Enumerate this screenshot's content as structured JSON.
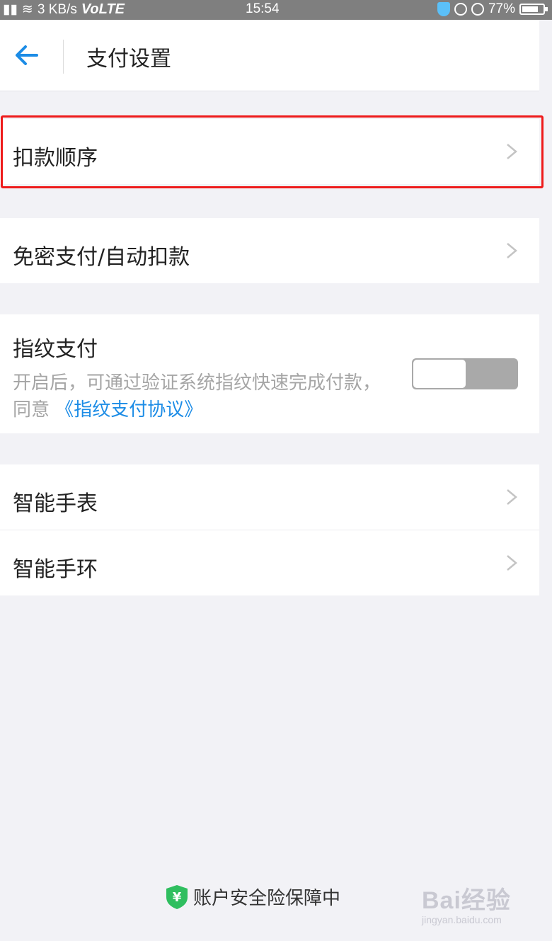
{
  "status_bar": {
    "speed": "3 KB/s",
    "network": "VoLTE",
    "time": "15:54",
    "battery": "77%"
  },
  "header": {
    "title": "支付设置"
  },
  "sections": {
    "deduction_order": "扣款顺序",
    "auto_pay": "免密支付/自动扣款",
    "fingerprint": {
      "title": "指纹支付",
      "desc": "开启后，可通过验证系统指纹快速完成付款，同意",
      "link": "《指纹支付协议》",
      "enabled": false
    },
    "smart_watch": "智能手表",
    "smart_band": "智能手环"
  },
  "footer": {
    "text": "账户安全险保障中"
  },
  "watermark": {
    "brand": "Bai经验",
    "url": "jingyan.baidu.com"
  },
  "colors": {
    "accent": "#1c8ce6",
    "highlight_border": "#ee1b1b",
    "shield_green": "#2fbe5f",
    "background": "#f2f2f6"
  }
}
